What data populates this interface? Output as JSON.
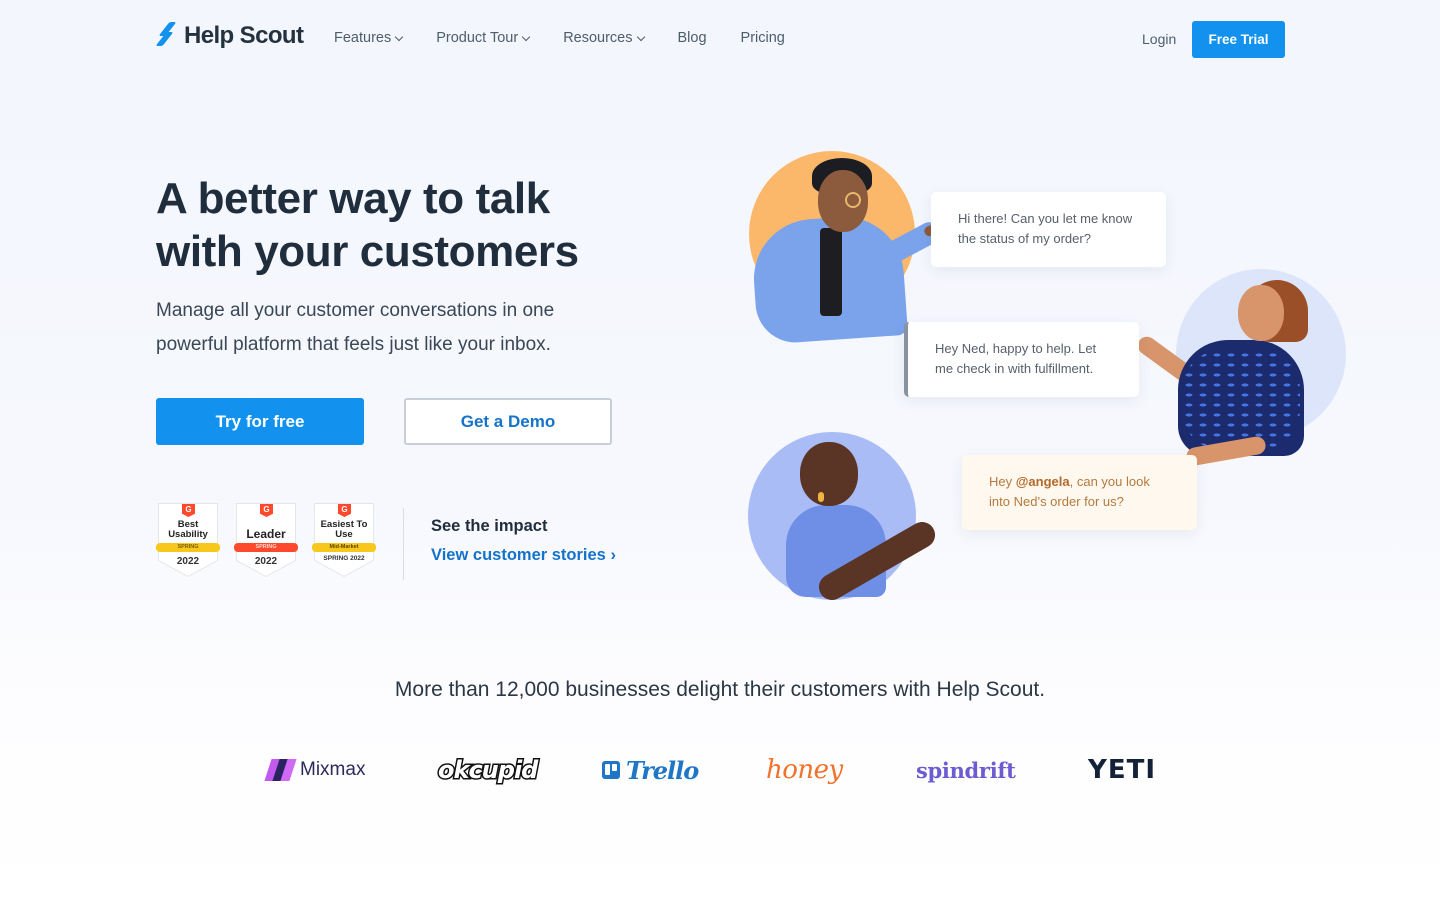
{
  "nav": {
    "brand": "Help Scout",
    "links": [
      {
        "label": "Features",
        "has_dropdown": true
      },
      {
        "label": "Product Tour",
        "has_dropdown": true
      },
      {
        "label": "Resources",
        "has_dropdown": true
      },
      {
        "label": "Blog",
        "has_dropdown": false
      },
      {
        "label": "Pricing",
        "has_dropdown": false
      }
    ],
    "login": "Login",
    "cta": "Free Trial"
  },
  "hero": {
    "title": "A better way to talk with your customers",
    "subtitle": "Manage all your customer conversations in one powerful platform that feels just like your inbox.",
    "primary_button": "Try for free",
    "secondary_button": "Get a Demo"
  },
  "badges": [
    {
      "brand": "G",
      "title": "Best Usability",
      "ribbon": "SPRING",
      "ribbon_color": "#f7c71c",
      "year": "2022"
    },
    {
      "brand": "G",
      "title": "Leader",
      "ribbon": "SPRING",
      "ribbon_color": "#ff492c",
      "year": "2022"
    },
    {
      "brand": "G",
      "title": "Easiest To Use",
      "ribbon": "Mid-Market",
      "ribbon_color": "#f7c71c",
      "year": "SPRING 2022"
    }
  ],
  "impact": {
    "heading": "See the impact",
    "link": "View customer stories ›"
  },
  "conversation": [
    {
      "text": "Hi there! Can you let me know the status of my order?"
    },
    {
      "text": "Hey Ned, happy to help. Let me check in with fulfillment."
    },
    {
      "prefix": "Hey ",
      "mention": "@angela",
      "suffix": ", can you look into Ned’s order for us?"
    }
  ],
  "social_proof": {
    "text": "More than 12,000 businesses delight their customers with Help Scout.",
    "logos": [
      "Mixmax",
      "okcupid",
      "Trello",
      "honey",
      "spindrift",
      "YETI"
    ]
  },
  "colors": {
    "accent": "#1292ee",
    "link": "#1573c9",
    "heading": "#1f2d3d"
  }
}
